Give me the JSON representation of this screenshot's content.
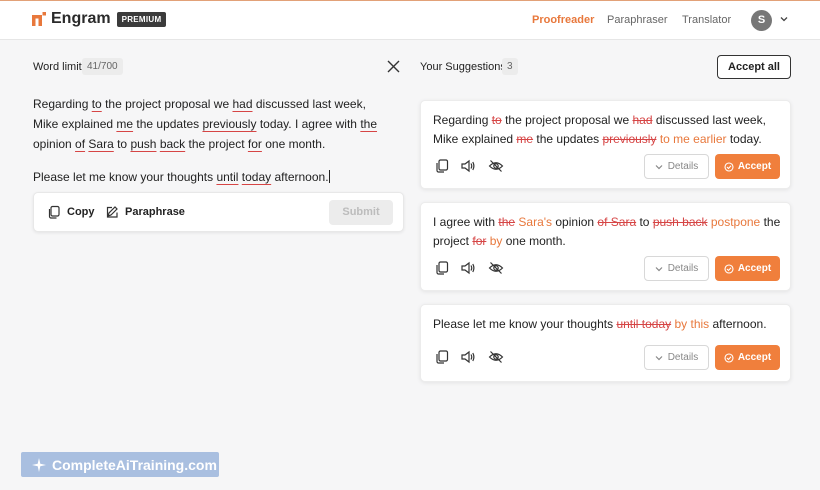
{
  "header": {
    "brand": "Engram",
    "badge": "PREMIUM",
    "nav": [
      {
        "label": "Proofreader",
        "active": true
      },
      {
        "label": "Paraphraser",
        "active": false
      },
      {
        "label": "Translator",
        "active": false
      }
    ],
    "avatar_initial": "S"
  },
  "editor": {
    "word_limit_label": "Word limit",
    "word_count": "41/700",
    "p1": {
      "t1": "Regarding ",
      "u1": "to",
      "t2": " the project proposal we ",
      "u2": "had",
      "t3": " discussed last week, Mike explained ",
      "u3": "me",
      "t4": " the updates ",
      "u4": "previously",
      "t5": " today. I agree with ",
      "u5": "the",
      "t6": " opinion ",
      "u6": "of",
      "t7": " ",
      "u7": "Sara",
      "t8": " to ",
      "u8": "push",
      "t9": " ",
      "u9": "back",
      "t10": " the project ",
      "u10": "for",
      "t11": " one month."
    },
    "p2": {
      "t1": "Please let me know your thoughts ",
      "u1": "until",
      "t2": " ",
      "u2": "today",
      "t3": " afternoon."
    },
    "copy_label": "Copy",
    "paraphrase_label": "Paraphrase",
    "submit_label": "Submit"
  },
  "suggestions": {
    "title": "Your Suggestions",
    "count": "3",
    "accept_all_label": "Accept all",
    "details_label": "Details",
    "accept_label": "Accept",
    "cards": [
      {
        "a": "Regarding ",
        "d1": "to",
        "b": " the project proposal we ",
        "d2": "had",
        "c": " discussed last week, Mike explained ",
        "d3": "me",
        "e": " the updates ",
        "d4": "previously",
        "i1": " to me earlier",
        "f": " today."
      },
      {
        "a": "I agree with ",
        "d1": "the",
        "i1": " Sara's",
        "b": " opinion ",
        "d2": "of Sara",
        "c": " to ",
        "d3": "push back",
        "i2": " postpone",
        "e": " the project ",
        "d4": "for",
        "i3": " by",
        "f": " one month."
      },
      {
        "a": "Please let me know your thoughts ",
        "d1": "until today",
        "i1": " by this",
        "b": " afternoon."
      }
    ]
  },
  "watermark": "CompleteAiTraining.com",
  "colors": {
    "accent": "#f07f3c",
    "error": "#d64545",
    "watermark": "#a9bfe0"
  }
}
